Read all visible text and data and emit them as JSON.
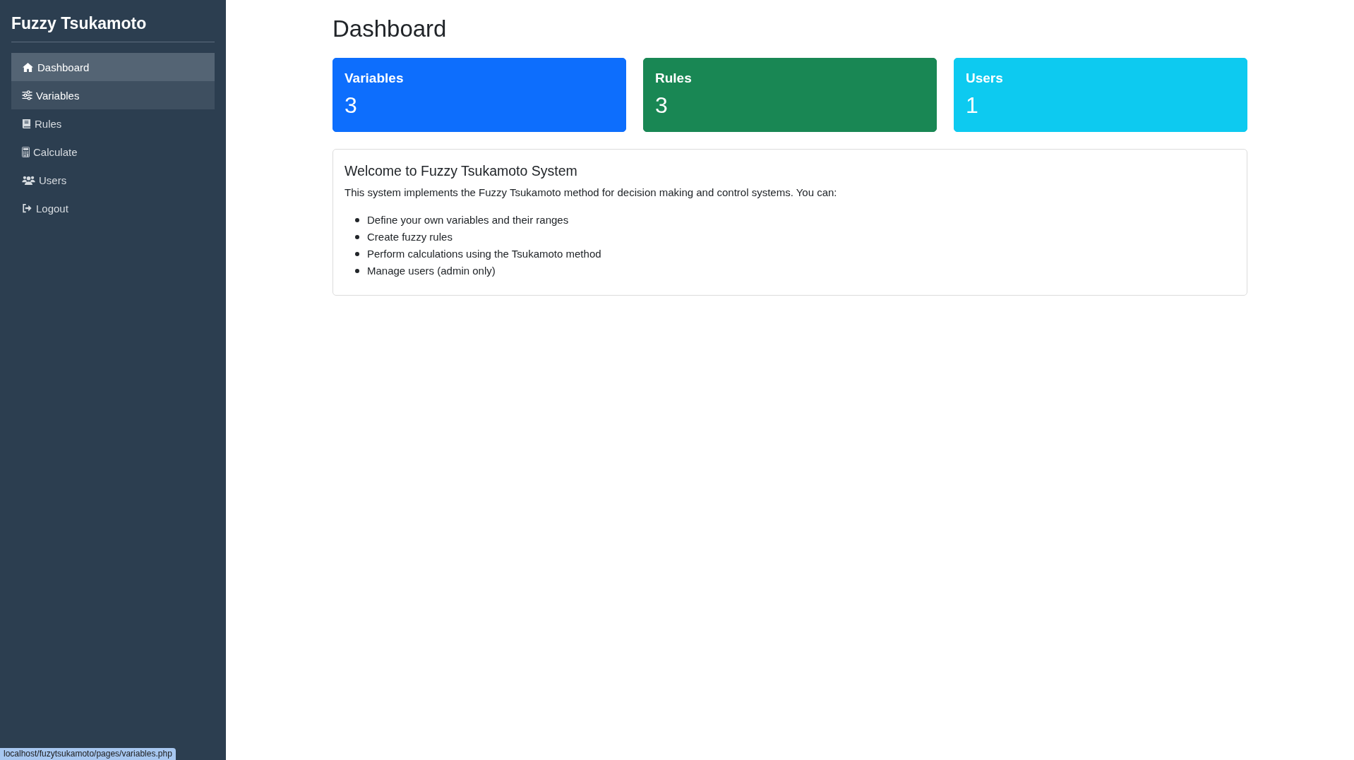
{
  "sidebar": {
    "brand": "Fuzzy Tsukamoto",
    "items": [
      {
        "label": "Dashboard",
        "selected": true,
        "hovered": false
      },
      {
        "label": "Variables",
        "selected": false,
        "hovered": true
      },
      {
        "label": "Rules",
        "selected": false,
        "hovered": false
      },
      {
        "label": "Calculate",
        "selected": false,
        "hovered": false
      },
      {
        "label": "Users",
        "selected": false,
        "hovered": false
      },
      {
        "label": "Logout",
        "selected": false,
        "hovered": false
      }
    ]
  },
  "page": {
    "title": "Dashboard"
  },
  "stats": [
    {
      "label": "Variables",
      "value": "3",
      "color": "#0d6efd"
    },
    {
      "label": "Rules",
      "value": "3",
      "color": "#198754"
    },
    {
      "label": "Users",
      "value": "1",
      "color": "#0dcaf0"
    }
  ],
  "welcome": {
    "title": "Welcome to Fuzzy Tsukamoto System",
    "text": "This system implements the Fuzzy Tsukamoto method for decision making and control systems. You can:",
    "bullets": [
      "Define your own variables and their ranges",
      "Create fuzzy rules",
      "Perform calculations using the Tsukamoto method",
      "Manage users (admin only)"
    ]
  },
  "status_bar": {
    "url": "localhost/fuzytsukamoto/pages/variables.php"
  }
}
